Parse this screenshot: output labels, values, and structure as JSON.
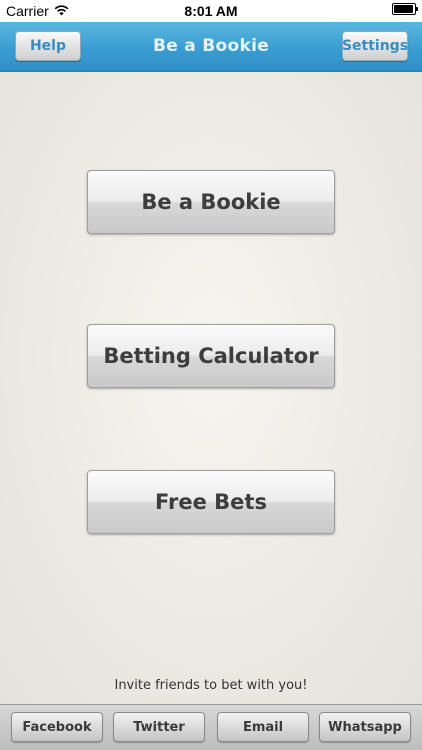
{
  "status_bar": {
    "carrier": "Carrier",
    "time": "8:01 AM",
    "wifi_icon": "wifi-icon",
    "battery_icon": "battery-icon"
  },
  "nav": {
    "title": "Be a Bookie",
    "help_label": "Help",
    "settings_label": "Settings"
  },
  "main": {
    "buttons": [
      {
        "label": "Be a Bookie"
      },
      {
        "label": "Betting Calculator"
      },
      {
        "label": "Free Bets"
      }
    ],
    "invite_text": "Invite friends to bet with you!"
  },
  "share": {
    "facebook_label": "Facebook",
    "twitter_label": "Twitter",
    "email_label": "Email",
    "whatsapp_label": "Whatsapp"
  },
  "colors": {
    "nav_accent": "#3a9dd1",
    "nav_button_text": "#3a8cc0",
    "background": "#ecebe4"
  }
}
